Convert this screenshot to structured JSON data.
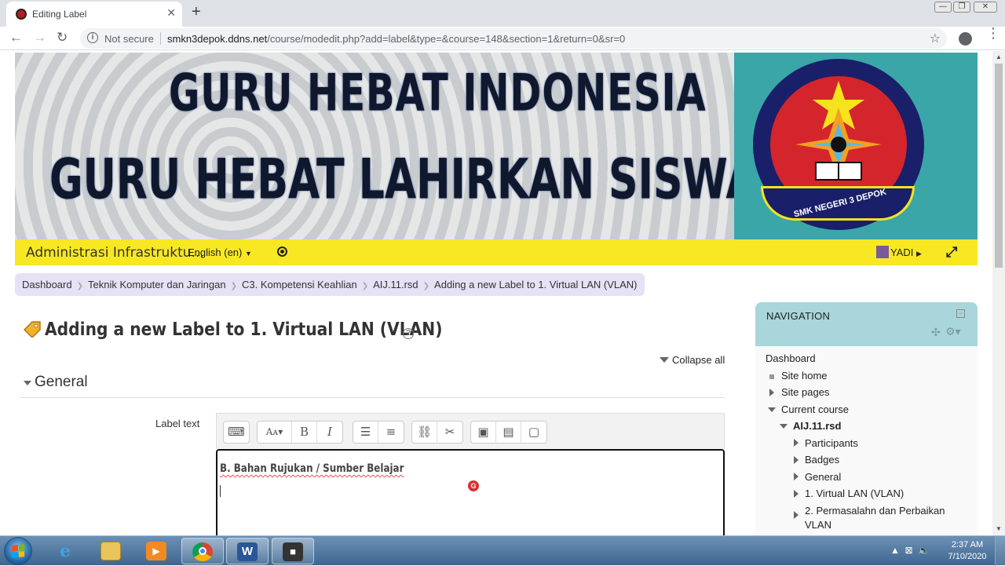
{
  "browser": {
    "tab_title": "Editing Label",
    "tab_close": "✕",
    "new_tab": "+",
    "not_secure": "Not secure",
    "url_host": "smkn3depok.ddns.net",
    "url_path": "/course/modedit.php?add=label&type=&course=148&section=1&return=0&sr=0",
    "win_min": "—",
    "win_restore": "❐",
    "win_close": "✕"
  },
  "banner": {
    "line1": "GURU HEBAT INDONESIA",
    "line2": "GURU HEBAT LAHIRKAN SISWA HEBAT",
    "seal_text": "SMK NEGERI 3 DEPOK"
  },
  "topbar": {
    "site_name": "Administrasi Infrastruktu...",
    "language": "English (en)",
    "user": "YADI"
  },
  "breadcrumb": [
    "Dashboard",
    "Teknik Komputer dan Jaringan",
    "C3. Kompetensi Keahlian",
    "AIJ.11.rsd",
    "Adding a new Label to 1. Virtual LAN (VLAN)"
  ],
  "main": {
    "title": "Adding a new Label to 1. Virtual LAN (VLAN)",
    "collapse_all": "Collapse all",
    "section": "General",
    "field_label": "Label text",
    "editor_text": "B. Bahan Rujukan / Sumber Belajar"
  },
  "navigation": {
    "title": "NAVIGATION",
    "items": [
      "Dashboard",
      "Site home",
      "Site pages",
      "Current course",
      "AIJ.11.rsd",
      "Participants",
      "Badges",
      "General",
      "1. Virtual LAN (VLAN)",
      "2. Permasalahn dan Perbaikan",
      "VLAN"
    ]
  },
  "taskbar": {
    "time": "2:37 AM",
    "date": "7/10/2020"
  },
  "colors": {
    "accent_yellow": "#f7e823",
    "breadcrumb_bg": "#e6e1f4",
    "nav_header": "#a8d6db",
    "banner_teal": "#3aa6a8"
  }
}
